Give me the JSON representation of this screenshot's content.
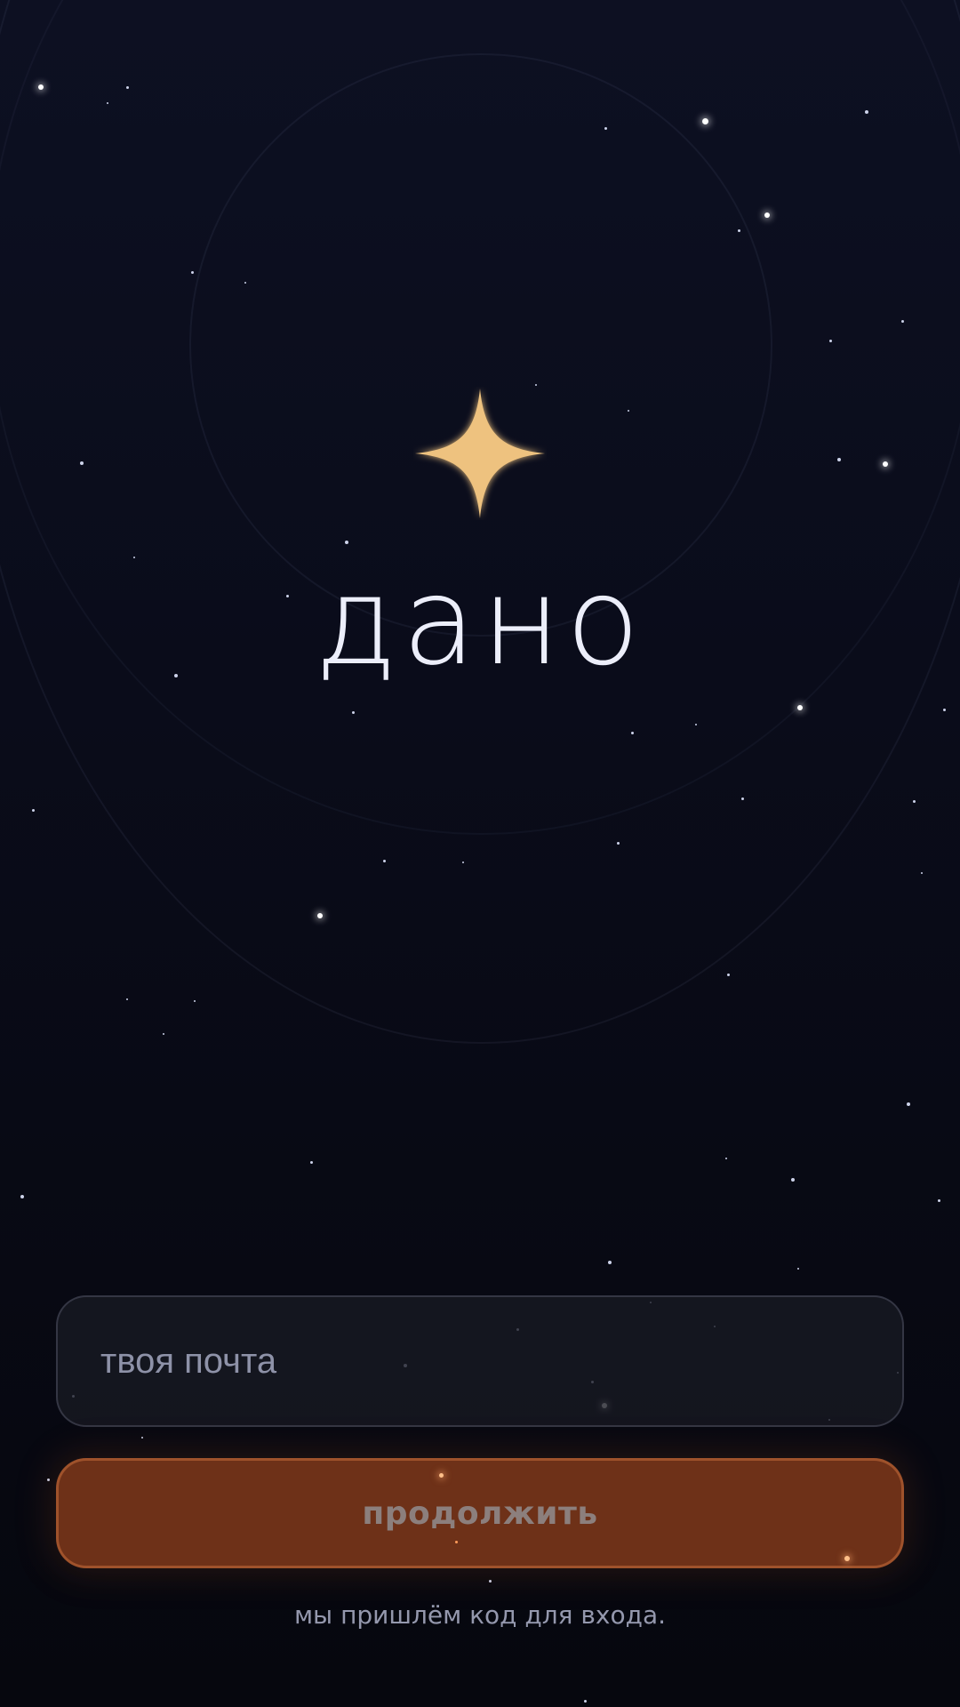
{
  "app": {
    "brand_name": "дано",
    "logo_icon": "four-point-star-icon",
    "accent_color": "#EEC27F"
  },
  "login": {
    "email_placeholder": "твоя почта",
    "email_value": "",
    "continue_label": "продолжить",
    "hint_text": "мы пришлём код для входа."
  },
  "colors": {
    "background": "#0A0C1A",
    "button_fill": "#6E3118",
    "button_text": "#8C7F7D",
    "field_fill": "#181922",
    "brand_text": "#ECEEFA"
  }
}
